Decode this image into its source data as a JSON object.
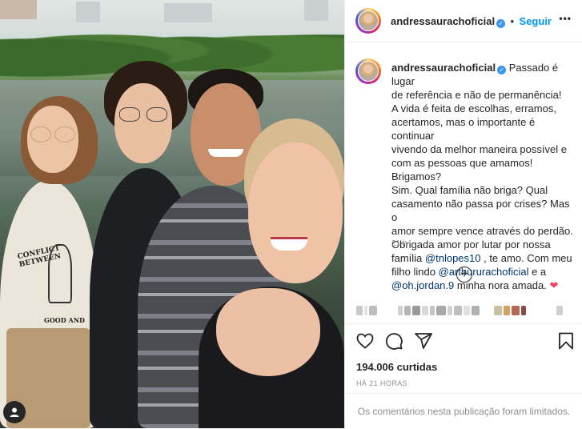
{
  "post": {
    "username": "andressaurachoficial",
    "follow_label": "Seguir",
    "more_label": "•••",
    "caption_lines": [
      "Passado é lugar",
      "de referência e não de permanência!",
      "A vida é feita de escolhas, erramos,",
      "acertamos, mas o importante é continuar",
      "vivendo da melhor maneira possível e",
      "com as pessoas que amamos! Brigamos?",
      "Sim. Qual família não briga? Qual",
      "casamento não passa por crises? Mas o",
      "amor sempre vence através do perdão.",
      "Obrigada amor por lutar por nossa"
    ],
    "caption_line11_pre": "família ",
    "mention_husband": "@tnlopes10",
    "caption_line11_post": " , te amo. Com meu",
    "caption_line12_pre": "filho lindo ",
    "mention_son": "@arthururachoficial",
    "caption_line12_post": " e a",
    "mention_jordan": "@oh.jordan.9",
    "caption_line13_post": " minha nora amada.",
    "heart_glyph": "❤",
    "caption_time": "21 h",
    "load_more_glyph": "+",
    "likes": "194.006 curtidas",
    "posted_ago": "HÁ 21 HORAS",
    "comments_limited": "Os comentários nesta publicação foram limitados."
  },
  "photo": {
    "sweater_text_1": "CONFLICT BETWEEN",
    "sweater_text_2": "GOOD AND"
  },
  "icons": [
    "verified-badge-icon",
    "more-options-icon",
    "plus-circle-icon",
    "heart-icon",
    "comment-icon",
    "share-icon",
    "bookmark-icon",
    "user-tag-icon"
  ],
  "colors": {
    "link": "#00376b",
    "follow": "#0095f6",
    "verified": "#3897f0",
    "heart": "#ed4956",
    "muted": "#8e8e8e"
  }
}
